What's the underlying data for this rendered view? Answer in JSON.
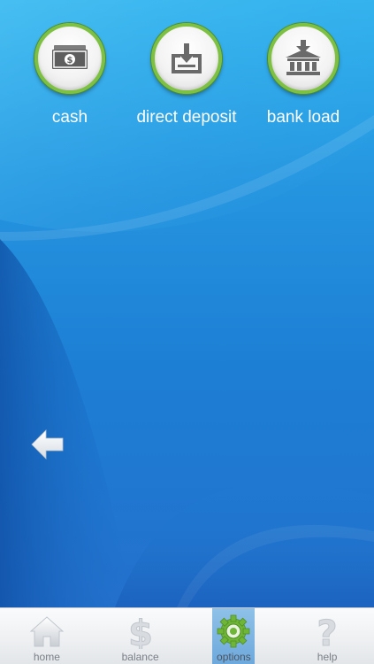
{
  "options": [
    {
      "id": "cash",
      "label": "cash",
      "icon": "cash-icon"
    },
    {
      "id": "direct_deposit",
      "label": "direct deposit",
      "icon": "direct-deposit-icon"
    },
    {
      "id": "bank_load",
      "label": "bank load",
      "icon": "bank-load-icon"
    }
  ],
  "back": {
    "icon": "back-arrow-icon"
  },
  "tabbar": {
    "tabs": [
      {
        "label": "home",
        "icon": "home-icon",
        "active": false
      },
      {
        "label": "balance",
        "icon": "dollar-icon",
        "active": false
      },
      {
        "label": "options",
        "icon": "gear-icon",
        "active": true
      },
      {
        "label": "help",
        "icon": "question-icon",
        "active": false
      }
    ]
  },
  "colors": {
    "background_top": "#2eb3ee",
    "background_bottom": "#2370cc",
    "ring_green": "#7ec142",
    "label_text": "#ffffff",
    "tab_active": "#6da8dc",
    "tab_text": "#7b8088"
  }
}
